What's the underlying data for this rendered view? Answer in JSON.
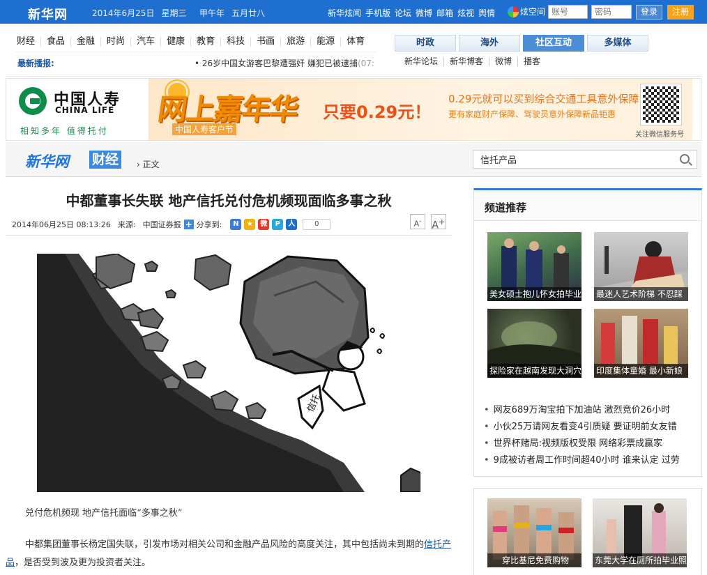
{
  "topbar": {
    "logo": "新华网",
    "date": "2014年6月25日",
    "weekday": "星期三",
    "lunar_year": "甲午年",
    "lunar_date": "五月廿八",
    "links": [
      "新华炫闻",
      "手机版",
      "论坛",
      "微博",
      "邮箱",
      "炫视",
      "舆情"
    ],
    "xuankongjian": "炫空间",
    "account_placeholder": "账号",
    "password_placeholder": "密码",
    "login": "登录",
    "register": "注册"
  },
  "nav": {
    "categories": [
      "财经",
      "食品",
      "金融",
      "时尚",
      "汽车",
      "健康",
      "教育",
      "科技",
      "书画",
      "旅游",
      "能源",
      "体育"
    ],
    "news_label": "最新播报:",
    "news_item": "• 26岁中国女游客巴黎遭强奸 嫌犯已被逮捕",
    "news_time": "(07:",
    "tabs": [
      "时政",
      "海外",
      "社区互动",
      "多媒体"
    ],
    "active_tab": 2,
    "subtabs": [
      "新华论坛",
      "新华博客",
      "微博",
      "播客"
    ]
  },
  "ad": {
    "brand_cn": "中国人寿",
    "brand_en": "CHINA LIFE",
    "slogan": "相知多年 值得托付",
    "headline": "网上嘉年华",
    "subline": "中国人寿客户节",
    "price": "只要0.29元！",
    "promo1": "0.29元就可以买到综合交通工具意外保障",
    "promo2": "更有家庭财产保障、驾驶员意外保障新品钜惠",
    "qr_text": "关注微信服务号"
  },
  "breadcrumb": {
    "site": "新华网",
    "section": "财经",
    "sep": "›",
    "current": "正文",
    "search_value": "信托产品"
  },
  "article": {
    "title": "中都董事长失联 地产信托兑付危机频现面临多事之秋",
    "datetime": "2014年06月25日 08:13:26",
    "source_label": "来源:",
    "source": "中国证券报",
    "share_label": "分享到:",
    "share_count": "0",
    "font_smaller": "A",
    "font_larger": "A",
    "caption": "兑付危机频现 地产信托面临“多事之秋”",
    "para_before": "中都集团董事长杨定国失联，引发市场对相关公司和金融产品风险的高度关注，其中包括尚未到期的",
    "para_link": "信托产品",
    "para_after": "，是否受到波及更为投资者关注。",
    "illus_sign": "信托"
  },
  "sidebar": {
    "title": "频道推荐",
    "pics": [
      {
        "caption": "美女硕士抱儿怀女拍毕业"
      },
      {
        "caption": "最迷人艺术阶梯 不忍踩"
      },
      {
        "caption": "探险家在越南发现大洞穴"
      },
      {
        "caption": "印度集体童婚 最小新娘"
      }
    ],
    "list": [
      "网友689万淘宝拍下加油站 激烈竞价26小时",
      "小伙25万请网友看变4引质疑 要证明前女友错",
      "世界杯赌局:视频版权受限 网络彩票成赢家",
      "9成被访者周工作时间超40小时 谁来认定 过劳"
    ],
    "pics2": [
      {
        "caption": "穿比基尼免费购物"
      },
      {
        "caption": "东莞大学在厕所拍毕业照"
      }
    ]
  },
  "colors": {
    "topbar": "#1f6fd0",
    "tab_active": "#4d8dd6",
    "link": "#1a5aa8",
    "register": "#f7a21b"
  }
}
